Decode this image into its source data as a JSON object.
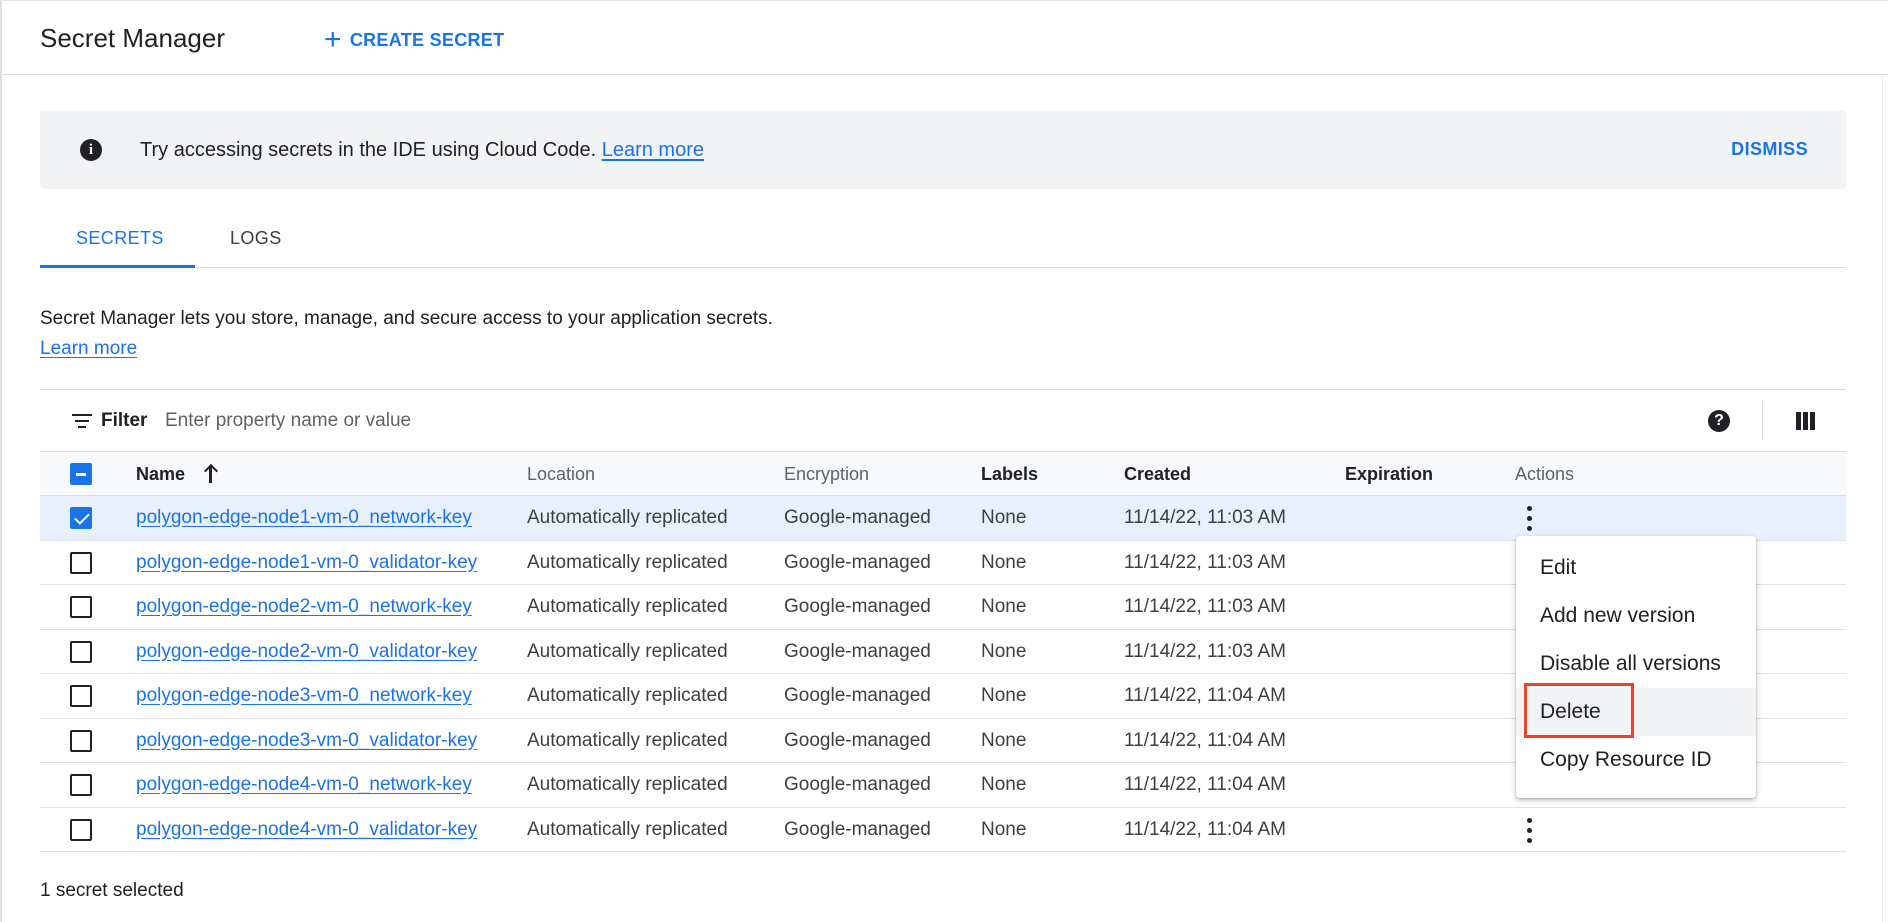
{
  "header": {
    "title": "Secret Manager",
    "create_label": "CREATE SECRET",
    "create_icon": "plus-icon"
  },
  "banner": {
    "icon": "info-icon",
    "message": "Try accessing secrets in the IDE using Cloud Code.",
    "link": "Learn more",
    "dismiss": "DISMISS"
  },
  "tabs": [
    {
      "label": "SECRETS",
      "active": true
    },
    {
      "label": "LOGS",
      "active": false
    }
  ],
  "description": {
    "text": "Secret Manager lets you store, manage, and secure access to your application secrets.",
    "link": "Learn more"
  },
  "filter": {
    "label": "Filter",
    "placeholder": "Enter property name or value",
    "icon": "filter-icon",
    "help_icon": "help-icon",
    "columns_icon": "column-display-icon"
  },
  "table": {
    "columns": [
      "Name",
      "Location",
      "Encryption",
      "Labels",
      "Created",
      "Expiration",
      "Actions"
    ],
    "sort": {
      "column": "Name",
      "direction": "ascending"
    },
    "rows": [
      {
        "name": "polygon-edge-node1-vm-0_network-key",
        "location": "Automatically replicated",
        "encryption": "Google-managed",
        "labels": "None",
        "created": "11/14/22, 11:03 AM",
        "expiration": "",
        "selected": true
      },
      {
        "name": "polygon-edge-node1-vm-0_validator-key",
        "location": "Automatically replicated",
        "encryption": "Google-managed",
        "labels": "None",
        "created": "11/14/22, 11:03 AM",
        "expiration": "",
        "selected": false
      },
      {
        "name": "polygon-edge-node2-vm-0_network-key",
        "location": "Automatically replicated",
        "encryption": "Google-managed",
        "labels": "None",
        "created": "11/14/22, 11:03 AM",
        "expiration": "",
        "selected": false
      },
      {
        "name": "polygon-edge-node2-vm-0_validator-key",
        "location": "Automatically replicated",
        "encryption": "Google-managed",
        "labels": "None",
        "created": "11/14/22, 11:03 AM",
        "expiration": "",
        "selected": false
      },
      {
        "name": "polygon-edge-node3-vm-0_network-key",
        "location": "Automatically replicated",
        "encryption": "Google-managed",
        "labels": "None",
        "created": "11/14/22, 11:04 AM",
        "expiration": "",
        "selected": false
      },
      {
        "name": "polygon-edge-node3-vm-0_validator-key",
        "location": "Automatically replicated",
        "encryption": "Google-managed",
        "labels": "None",
        "created": "11/14/22, 11:04 AM",
        "expiration": "",
        "selected": false
      },
      {
        "name": "polygon-edge-node4-vm-0_network-key",
        "location": "Automatically replicated",
        "encryption": "Google-managed",
        "labels": "None",
        "created": "11/14/22, 11:04 AM",
        "expiration": "",
        "selected": false
      },
      {
        "name": "polygon-edge-node4-vm-0_validator-key",
        "location": "Automatically replicated",
        "encryption": "Google-managed",
        "labels": "None",
        "created": "11/14/22, 11:04 AM",
        "expiration": "",
        "selected": false
      }
    ]
  },
  "actions_menu": {
    "items": [
      "Edit",
      "Add new version",
      "Disable all versions",
      "Delete",
      "Copy Resource ID"
    ],
    "highlighted": "Delete"
  },
  "footer": {
    "selection_status": "1 secret selected"
  },
  "colors": {
    "accent": "#1a73e8",
    "highlight_border": "#e8442a",
    "selected_row": "#e8f0fe"
  }
}
